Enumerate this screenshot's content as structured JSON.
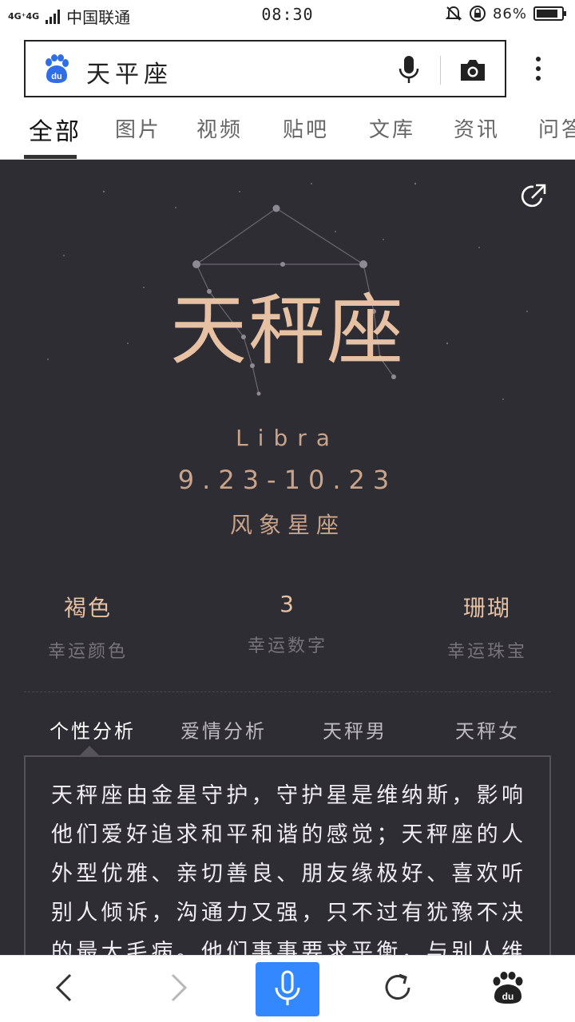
{
  "status_bar": {
    "network": "4G⁺4G",
    "carrier": "中国联通",
    "time": "08:30",
    "battery_percent": "86%",
    "battery_level": 0.86
  },
  "search": {
    "query": "天平座",
    "logo": "baidu-paw-icon"
  },
  "tabs": [
    {
      "label": "全部",
      "active": true
    },
    {
      "label": "图片"
    },
    {
      "label": "视频"
    },
    {
      "label": "贴吧"
    },
    {
      "label": "文库"
    },
    {
      "label": "资讯"
    },
    {
      "label": "问答"
    }
  ],
  "card": {
    "title": "天秤座",
    "english_name": "Libra",
    "date_range": "9.23-10.23",
    "element": "风象星座",
    "stats": [
      {
        "value": "褐色",
        "label": "幸运颜色"
      },
      {
        "value": "3",
        "label": "幸运数字"
      },
      {
        "value": "珊瑚",
        "label": "幸运珠宝"
      }
    ],
    "sub_tabs": [
      {
        "label": "个性分析",
        "active": true
      },
      {
        "label": "爱情分析"
      },
      {
        "label": "天秤男"
      },
      {
        "label": "天秤女"
      }
    ],
    "content": "天秤座由金星守护，守护星是维纳斯，影响他们爱好追求和平和谐的感觉；天秤座的人外型优雅、亲切善良、朋友缘极好、喜欢听别人倾诉，沟通力又强，只不过有犹豫不决的最大毛病。他们事事要求平衡，与别人维持深入关…"
  },
  "colors": {
    "card_bg": "#2f2d34",
    "accent": "#e6c1a3",
    "voice_button": "#3388ff"
  }
}
